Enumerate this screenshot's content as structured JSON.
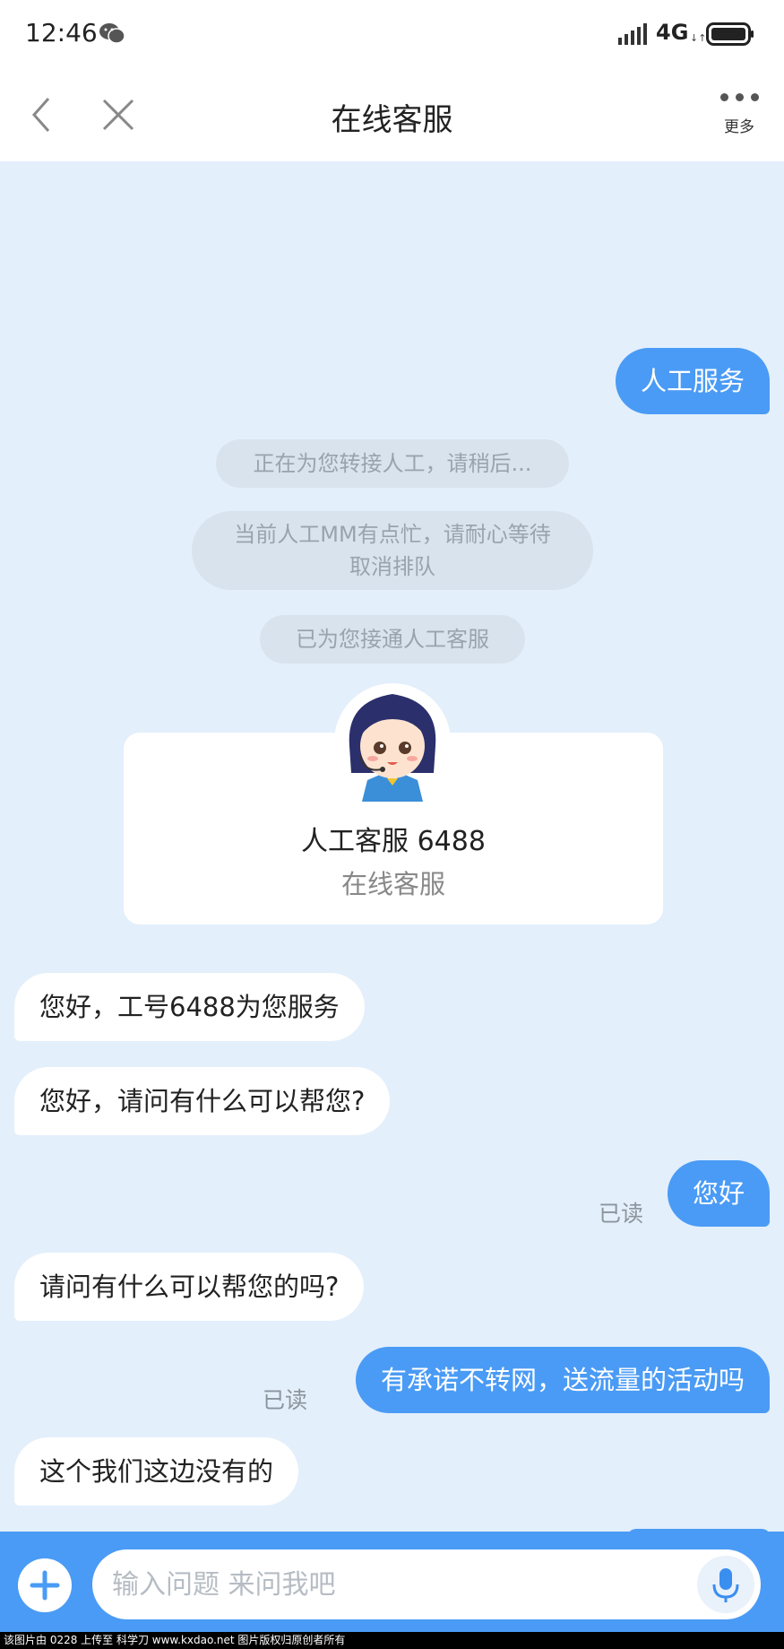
{
  "status_bar": {
    "time": "12:46",
    "network": "4G",
    "network_arrows": "↓↑"
  },
  "header": {
    "title": "在线客服",
    "more_label": "更多"
  },
  "messages": {
    "user_1": "人工服务",
    "system_1": "正在为您转接人工，请稍后...",
    "system_2_line1": "当前人工MM有点忙，请耐心等待",
    "system_2_line2": "取消排队",
    "system_3": "已为您接通人工客服",
    "agent_1": "您好，工号6488为您服务",
    "agent_2": "您好，请问有什么可以帮您?",
    "user_2": "您好",
    "user_2_status": "已读",
    "agent_3": "请问有什么可以帮您的吗?",
    "user_3": "有承诺不转网，送流量的活动吗",
    "user_3_status": "已读",
    "agent_4": "这个我们这边没有的"
  },
  "agent_card": {
    "name": "人工客服 6488",
    "role": "在线客服"
  },
  "input": {
    "placeholder": "输入问题 来问我吧"
  },
  "watermark": "该图片由 0228 上传至 科学刀 www.kxdao.net 图片版权归原创者所有",
  "colors": {
    "accent": "#4a9bf5",
    "background": "#e3effb",
    "system_note": "#d9e3ee"
  },
  "icons": [
    "wechat-icon",
    "signal-icon",
    "battery-icon",
    "back-icon",
    "close-icon",
    "more-icon",
    "agent-avatar",
    "plus-icon",
    "mic-icon"
  ]
}
